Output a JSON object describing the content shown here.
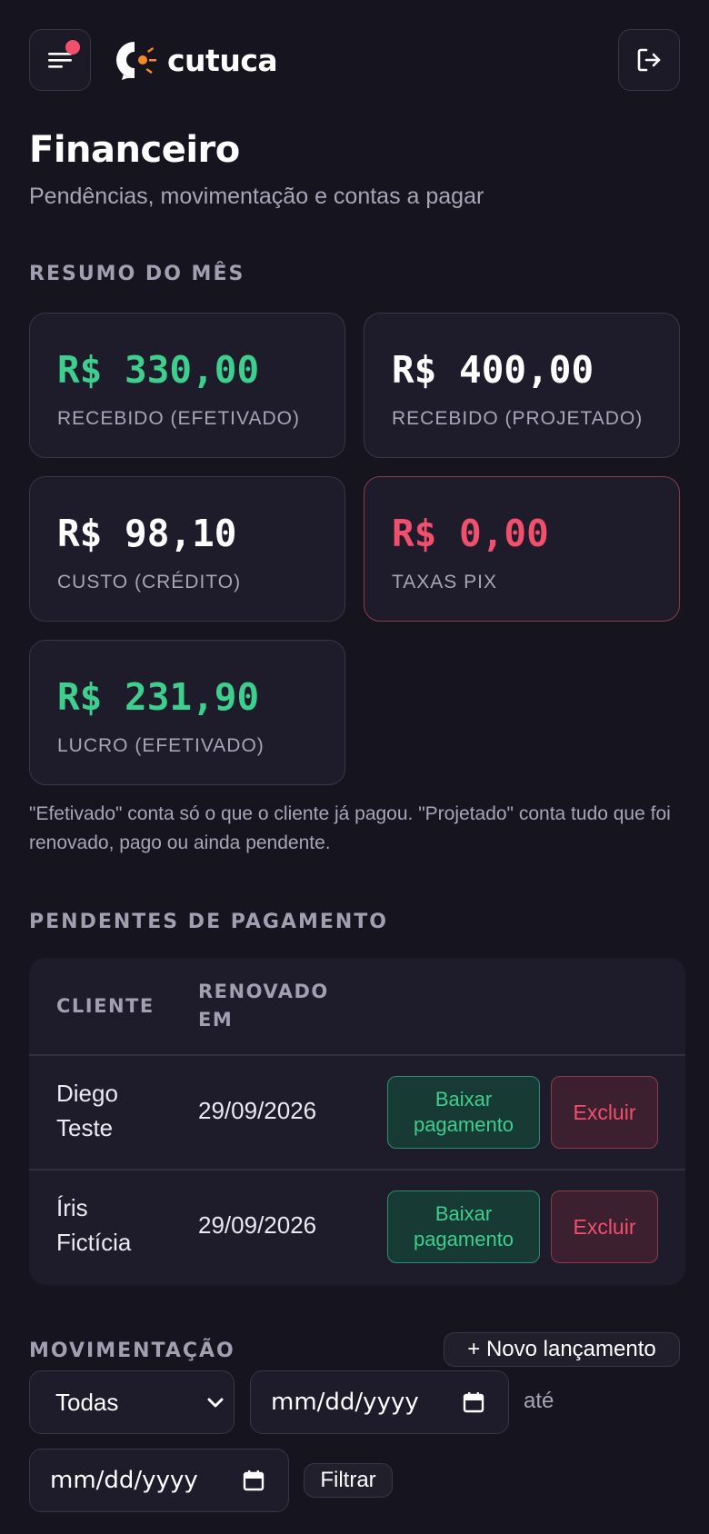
{
  "header": {
    "brand": "cutuca",
    "menu_icon": "hamburger-icon",
    "logout_icon": "logout-icon"
  },
  "page": {
    "title": "Financeiro",
    "subtitle": "Pendências, movimentação e contas a pagar"
  },
  "summary": {
    "label": "RESUMO DO MÊS",
    "cards": [
      {
        "value": "R$ 330,00",
        "caption": "RECEBIDO (EFETIVADO)",
        "color": "#3ecf8e"
      },
      {
        "value": "R$ 400,00",
        "caption": "RECEBIDO (PROJETADO)",
        "color": "#ffffff"
      },
      {
        "value": "R$ 98,10",
        "caption": "CUSTO (CRÉDITO)",
        "color": "#ffffff"
      },
      {
        "value": "R$ 0,00",
        "caption": "TAXAS PIX",
        "color": "#f0506e"
      },
      {
        "value": "R$ 231,90",
        "caption": "LUCRO (EFETIVADO)",
        "color": "#3ecf8e"
      }
    ],
    "note": "\"Efetivado\" conta só o que o cliente já pagou. \"Projetado\" conta tudo que foi renovado, pago ou ainda pendente."
  },
  "pending": {
    "label": "PENDENTES DE PAGAMENTO",
    "columns": [
      "CLIENTE",
      "RENOVADO EM"
    ],
    "col_cliente": "CLIENTE",
    "col_renovado_1": "RENOVADO",
    "col_renovado_2": "EM",
    "rows": [
      {
        "name_1": "Diego",
        "name_2": "Teste",
        "date": "29/09/2026",
        "pay_1": "Baixar",
        "pay_2": "pagamento",
        "delete": "Excluir"
      },
      {
        "name_1": "Íris",
        "name_2": "Fictícia",
        "date": "29/09/2026",
        "pay_1": "Baixar",
        "pay_2": "pagamento",
        "delete": "Excluir"
      }
    ]
  },
  "movement": {
    "label": "MOVIMENTAÇÃO",
    "new_button": "+ Novo lançamento",
    "filter_select": "Todas",
    "date_from": "mm/dd/yyyy",
    "until": "até",
    "date_to": "mm/dd/yyyy",
    "filter_button": "Filtrar"
  },
  "colors": {
    "accent_green": "#3ecf8e",
    "accent_red": "#f0506e",
    "logo_orange": "#f58a2a",
    "background": "#16141f"
  }
}
